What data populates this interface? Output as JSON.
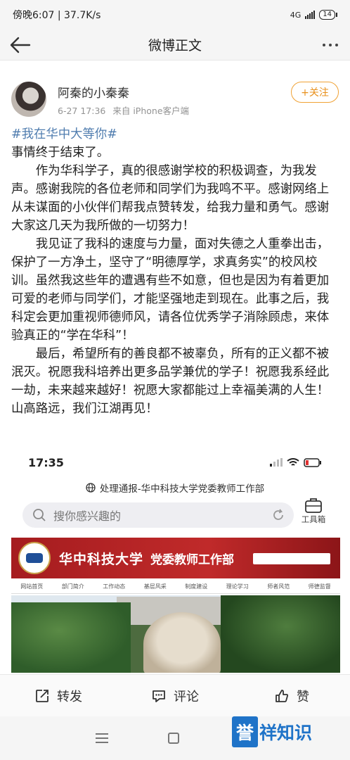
{
  "status_bar": {
    "time_text": "傍晚6:07 | 37.7K/s",
    "network": "4G",
    "battery": "14"
  },
  "nav": {
    "title": "微博正文"
  },
  "author": {
    "name": "阿秦的小秦秦",
    "date": "6-27 17:36",
    "source": "来自 iPhone客户端",
    "follow_label": "+关注"
  },
  "post": {
    "hashtag": "#我在华中大等你#",
    "paragraphs": [
      "事情终于结束了。",
      "作为华科学子，真的很感谢学校的积极调查，为我发声。感谢我院的各位老师和同学们为我鸣不平。感谢网络上从未谋面的小伙伴们帮我点赞转发，给我力量和勇气。感谢大家这几天为我所做的一切努力！",
      "我见证了我科的速度与力量，面对失德之人重拳出击，保护了一方净土，坚守了“明德厚学，求真务实”的校风校训。虽然我这些年的遭遇有些不如意，但也是因为有着更加可爱的老师与同学们，才能坚强地走到现在。此事之后，我科定会更加重视师德师风，请各位优秀学子消除顾虑，来体验真正的“学在华科”！",
      "最后，希望所有的善良都不被辜负，所有的正义都不被泯灭。祝愿我科培养出更多品学兼优的学子！祝愿我系经此一劫，未来越来越好！祝愿大家都能过上幸福美满的人生！山高路远，我们江湖再见！"
    ]
  },
  "embedded_screenshot": {
    "time": "17:35",
    "page_title": "处理通报-华中科技大学党委教师工作部",
    "search_placeholder": "搜你感兴趣的",
    "tools_label": "工具箱",
    "university": "华中科技大学",
    "department": "党委教师工作部",
    "menu_items": [
      "网站首页",
      "部门简介",
      "工作动态",
      "基层风采",
      "制度建设",
      "理论学习",
      "师者风范",
      "师德监督"
    ]
  },
  "actions": {
    "repost": "转发",
    "comment": "评论",
    "like": "赞"
  },
  "watermark": {
    "box": "誉",
    "rest": "祥知识"
  }
}
